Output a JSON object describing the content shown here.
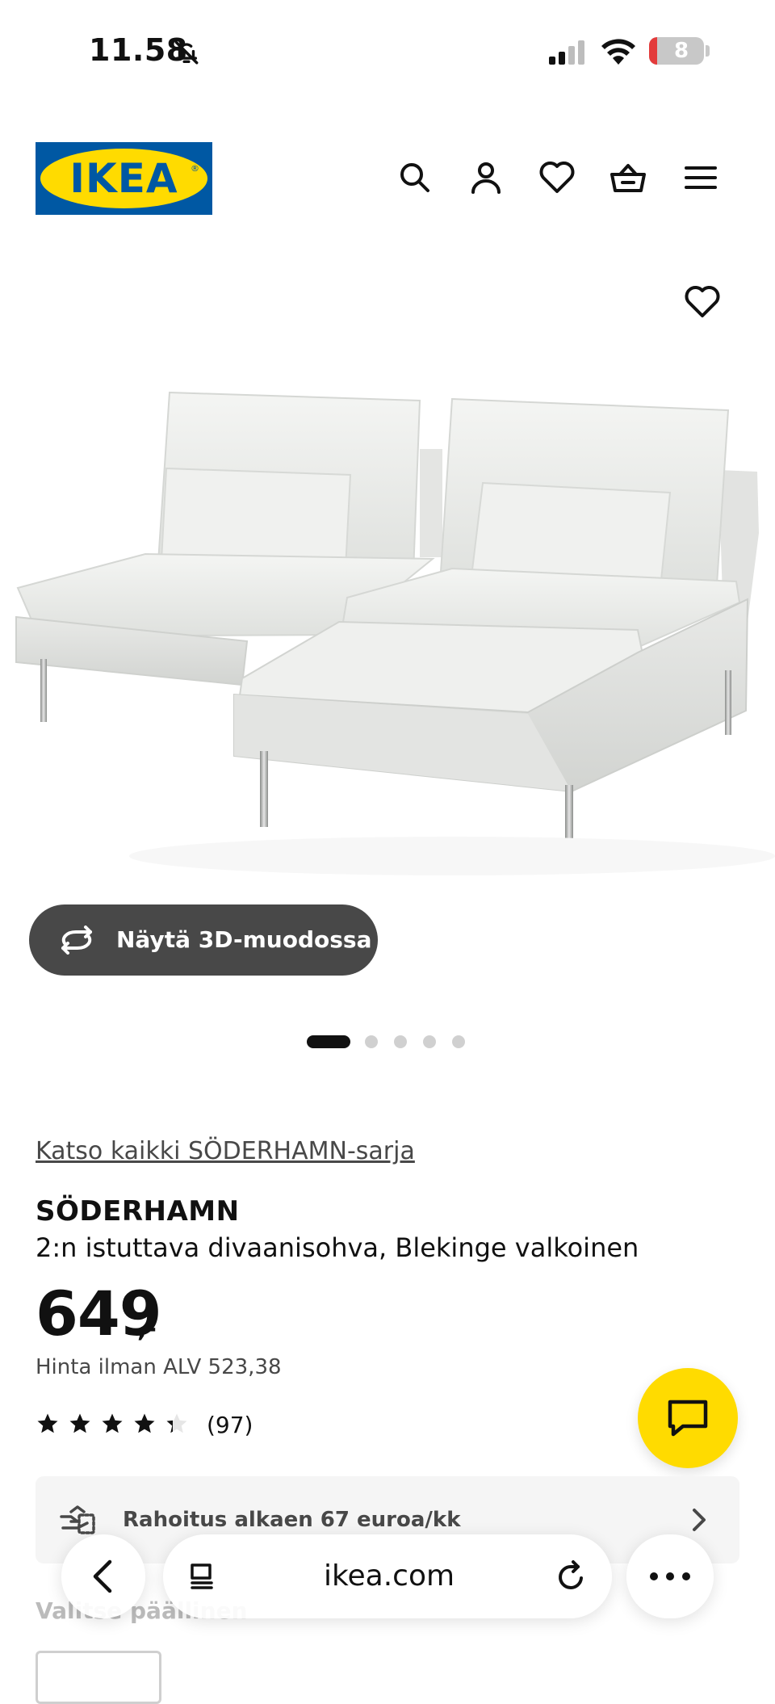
{
  "status_bar": {
    "time": "11.58",
    "battery": "8"
  },
  "header": {
    "logo_text": "IKEA"
  },
  "gallery": {
    "view3d_label": "Näytä 3D-muodossa",
    "image_count": 5,
    "active_index": 1
  },
  "product": {
    "series_link": "Katso kaikki SÖDERHAMN-sarja",
    "name": "SÖDERHAMN",
    "description": "2:n istuttava divaanisohva, Blekinge valkoinen",
    "price": "649",
    "price_suffix": ",-",
    "vat_note": "Hinta ilman ALV 523,38",
    "rating": 4.3,
    "rating_max": 5,
    "review_count": "(97)"
  },
  "finance": {
    "label": "Rahoitus alkaen 67 euroa/kk"
  },
  "options": {
    "heading": "Valitse päällinen"
  },
  "browser": {
    "host": "ikea.com"
  },
  "colors": {
    "ikea_blue": "#0058a3",
    "ikea_yellow": "#ffdb00",
    "dark_button": "#484848"
  }
}
